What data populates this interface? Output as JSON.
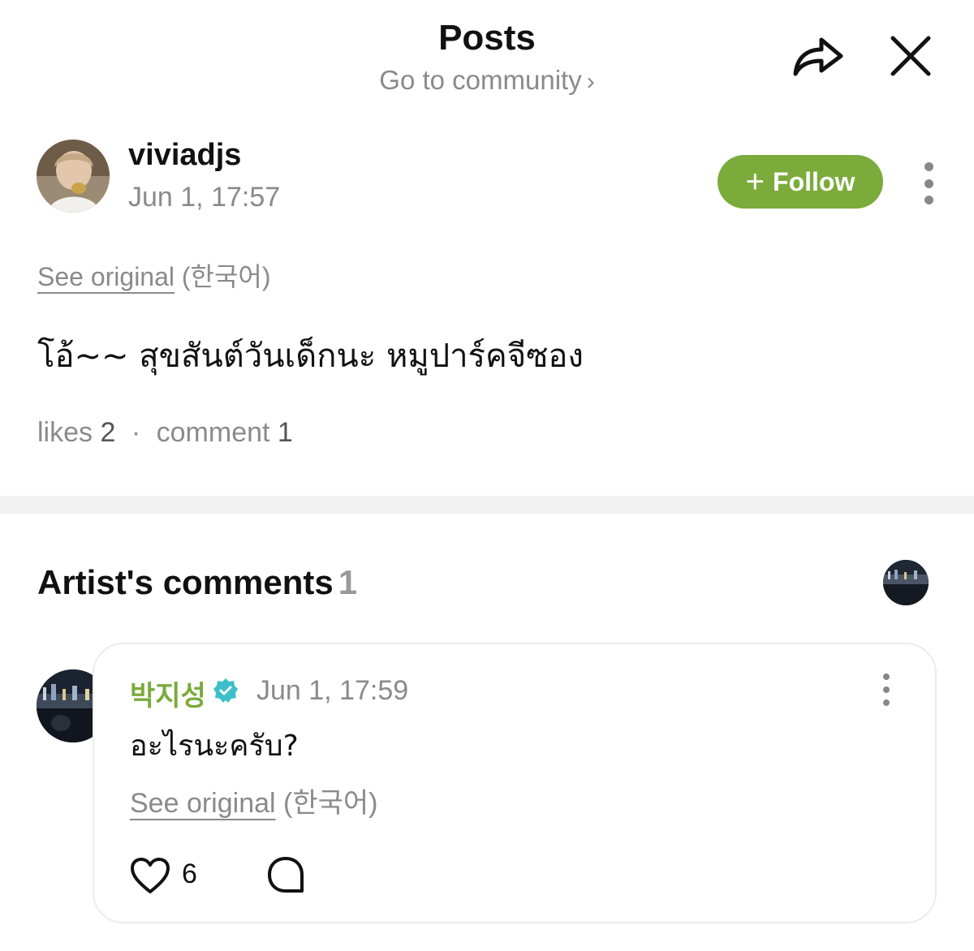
{
  "header": {
    "title": "Posts",
    "community_link": "Go to community",
    "chevron": "›",
    "share_icon": "share-arrow-icon",
    "close_icon": "close-icon"
  },
  "post": {
    "username": "viviadjs",
    "timestamp": "Jun 1, 17:57",
    "follow_label": "Follow",
    "follow_plus": "+",
    "see_original": "See original",
    "original_language": "(한국어)",
    "body": "โอ้~~ สุขสันต์วันเด็กนะ หมูปาร์คจีซอง",
    "likes_label": "likes",
    "likes_count": "2",
    "comment_label": "comment",
    "comment_count": "1",
    "separator": "·"
  },
  "artist_comments": {
    "title": "Artist's comments",
    "count": "1",
    "comments": [
      {
        "author": "박지성",
        "verified_icon": "verified-badge-icon",
        "timestamp": "Jun 1, 17:59",
        "text": "อะไรนะครับ?",
        "see_original": "See original",
        "original_language": "(한국어)",
        "like_count": "6"
      }
    ]
  },
  "colors": {
    "accent_green": "#7bab3b",
    "muted_text": "#8a8a8a",
    "verified_teal": "#3cbfc9"
  }
}
